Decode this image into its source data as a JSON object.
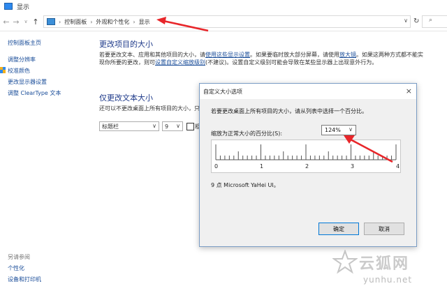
{
  "window": {
    "title": "显示"
  },
  "address": {
    "crumbs": [
      "控制面板",
      "外观和个性化",
      "显示"
    ],
    "dropdown": "∨"
  },
  "sidebar": {
    "home": "控制面板主页",
    "items": [
      {
        "label": "调整分辨率"
      },
      {
        "label": "校准颜色"
      },
      {
        "label": "更改显示器设置"
      },
      {
        "label": "调整 ClearType 文本"
      }
    ],
    "see_also": "另请参阅",
    "bottom_items": [
      {
        "label": "个性化"
      },
      {
        "label": "设备和打印机"
      }
    ]
  },
  "main": {
    "title": "更改项目的大小",
    "desc_1": "若要更改文本、应用和其他项目的大小，请",
    "desc_link_1": "使用这些显示设置",
    "desc_2": "。如果要临时放大部分屏幕，请使用",
    "desc_link_2": "放大镜",
    "desc_3": "。如果这两种方式都不能实现你所要的更改，则可",
    "desc_link_3": "设置自定义缩放级别",
    "desc_4": "(不建议)。设置自定义级别可能会导致在某些显示器上出现意外行为。",
    "text_only_title": "仅更改文本大小",
    "text_only_desc": "还可以不更改桌面上所有项目的大小，只",
    "item_select": "标题栏",
    "size_select": "9",
    "bold_label": "粗"
  },
  "dialog": {
    "title": "自定义大小选项",
    "close": "×",
    "instruction": "若要更改桌面上所有项目的大小，请从列表中选择一个百分比。",
    "scale_label": "缩放为正常大小的百分比(S):",
    "scale_value": "124%",
    "ruler_labels": [
      "0",
      "1",
      "2",
      "3",
      "4"
    ],
    "font_info": "9 点 Microsoft YaHei UI。",
    "ok_label": "确定",
    "cancel_label": "取消"
  },
  "watermark": {
    "name": "云狐网",
    "url": "yunhu.net"
  },
  "colors": {
    "accent_arrow": "#e8262a",
    "link": "#1a4d99",
    "heading": "#1e3a8a"
  }
}
